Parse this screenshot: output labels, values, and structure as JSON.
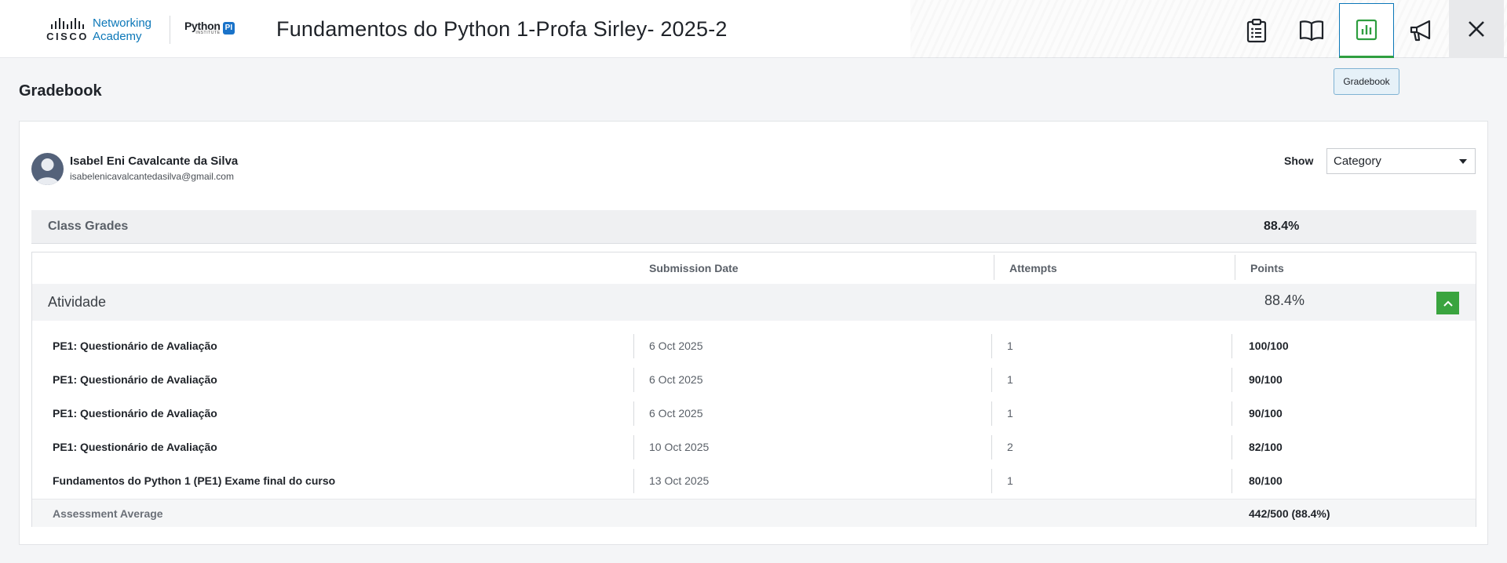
{
  "header": {
    "cisco_word": "CISCO",
    "academy_line1": "Networking",
    "academy_line2": "Academy",
    "python_word": "Python",
    "python_sub": "INSTITUTE",
    "pi_badge": "PI",
    "course_title": "Fundamentos do Python 1-Profa Sirley- 2025-2",
    "nav": [
      {
        "name": "assignments",
        "icon": "clipboard-icon"
      },
      {
        "name": "course",
        "icon": "book-icon"
      },
      {
        "name": "gradebook",
        "icon": "bar-chart-icon",
        "active": true
      },
      {
        "name": "announcements",
        "icon": "megaphone-icon"
      },
      {
        "name": "close",
        "icon": "close-icon"
      }
    ],
    "tooltip": "Gradebook",
    "accent_active": "#2e9e3f",
    "accent_link": "#0b77b8"
  },
  "page": {
    "title": "Gradebook"
  },
  "student": {
    "name": "Isabel Eni Cavalcante da Silva",
    "email": "isabelenicavalcantedasilva@gmail.com"
  },
  "filter": {
    "show_label": "Show",
    "selected": "Category"
  },
  "class_grades": {
    "label": "Class Grades",
    "value": "88.4%"
  },
  "table": {
    "headers": {
      "submission_date": "Submission Date",
      "attempts": "Attempts",
      "points": "Points"
    },
    "category": {
      "label": "Atividade",
      "value": "88.4%"
    },
    "rows": [
      {
        "name": "PE1: Questionário de Avaliação",
        "date": "6 Oct 2025",
        "attempts": "1",
        "points": "100/100"
      },
      {
        "name": "PE1: Questionário de Avaliação",
        "date": "6 Oct 2025",
        "attempts": "1",
        "points": "90/100"
      },
      {
        "name": "PE1: Questionário de Avaliação",
        "date": "6 Oct 2025",
        "attempts": "1",
        "points": "90/100"
      },
      {
        "name": "PE1: Questionário de Avaliação",
        "date": "10 Oct 2025",
        "attempts": "2",
        "points": "82/100"
      },
      {
        "name": "Fundamentos do Python 1 (PE1) Exame final do curso",
        "date": "13 Oct 2025",
        "attempts": "1",
        "points": "80/100"
      }
    ],
    "average": {
      "label": "Assessment Average",
      "value": "442/500 (88.4%)"
    }
  }
}
